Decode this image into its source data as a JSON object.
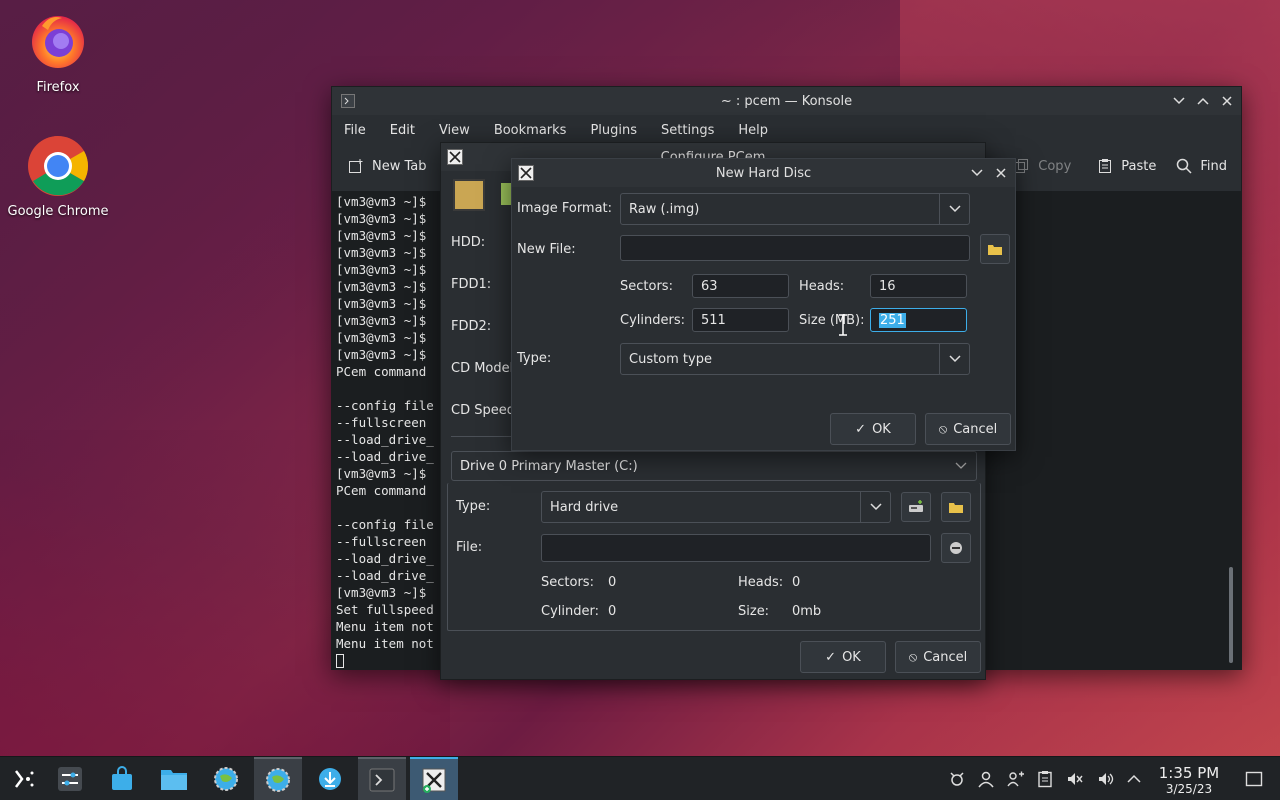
{
  "desktop": {
    "icons": [
      {
        "label": "Firefox"
      },
      {
        "label": "Google Chrome"
      }
    ]
  },
  "konsole": {
    "title": "~ : pcem — Konsole",
    "menu": [
      "File",
      "Edit",
      "View",
      "Bookmarks",
      "Plugins",
      "Settings",
      "Help"
    ],
    "toolbar": {
      "new_tab": "New Tab",
      "copy": "Copy",
      "paste": "Paste",
      "find": "Find"
    },
    "lines": [
      "[vm3@vm3 ~]$",
      "[vm3@vm3 ~]$",
      "[vm3@vm3 ~]$",
      "[vm3@vm3 ~]$",
      "[vm3@vm3 ~]$",
      "[vm3@vm3 ~]$",
      "[vm3@vm3 ~]$",
      "[vm3@vm3 ~]$",
      "[vm3@vm3 ~]$",
      "[vm3@vm3 ~]$",
      "PCem command",
      "",
      "--config file",
      "--fullscreen",
      "--load_drive_",
      "--load_drive_",
      "[vm3@vm3 ~]$",
      "PCem command",
      "",
      "--config file",
      "--fullscreen",
      "--load_drive_",
      "--load_drive_",
      "[vm3@vm3 ~]$",
      "Set fullspeed",
      "Menu item not",
      "Menu item not"
    ]
  },
  "configure": {
    "title": "Configure PCem",
    "labels": {
      "hdd": "HDD:",
      "fdd1": "FDD1:",
      "fdd2": "FDD2:",
      "cd_model": "CD Model",
      "cd_speed": "CD Speed"
    },
    "drive_select": "Drive 0 Primary Master (C:)",
    "type_label": "Type:",
    "type_value": "Hard drive",
    "file_label": "File:",
    "file_value": "",
    "sectors_label": "Sectors:",
    "sectors_value": "0",
    "heads_label": "Heads:",
    "heads_value": "0",
    "cylinder_label": "Cylinder:",
    "cylinder_value": "0",
    "size_label": "Size:",
    "size_value": "0mb",
    "ok": "OK",
    "cancel": "Cancel"
  },
  "new_hard_disc": {
    "title": "New Hard Disc",
    "image_format_label": "Image Format:",
    "image_format_value": "Raw (.img)",
    "new_file_label": "New File:",
    "new_file_value": "",
    "sectors_label": "Sectors:",
    "sectors_value": "63",
    "heads_label": "Heads:",
    "heads_value": "16",
    "cylinders_label": "Cylinders:",
    "cylinders_value": "511",
    "size_label": "Size (MB):",
    "size_value": "251",
    "type_label": "Type:",
    "type_value": "Custom type",
    "ok": "OK",
    "cancel": "Cancel"
  },
  "taskbar": {
    "time": "1:35 PM",
    "date": "3/25/23"
  },
  "colors": {
    "accent": "#3daee9",
    "selection": "#3daee9"
  }
}
